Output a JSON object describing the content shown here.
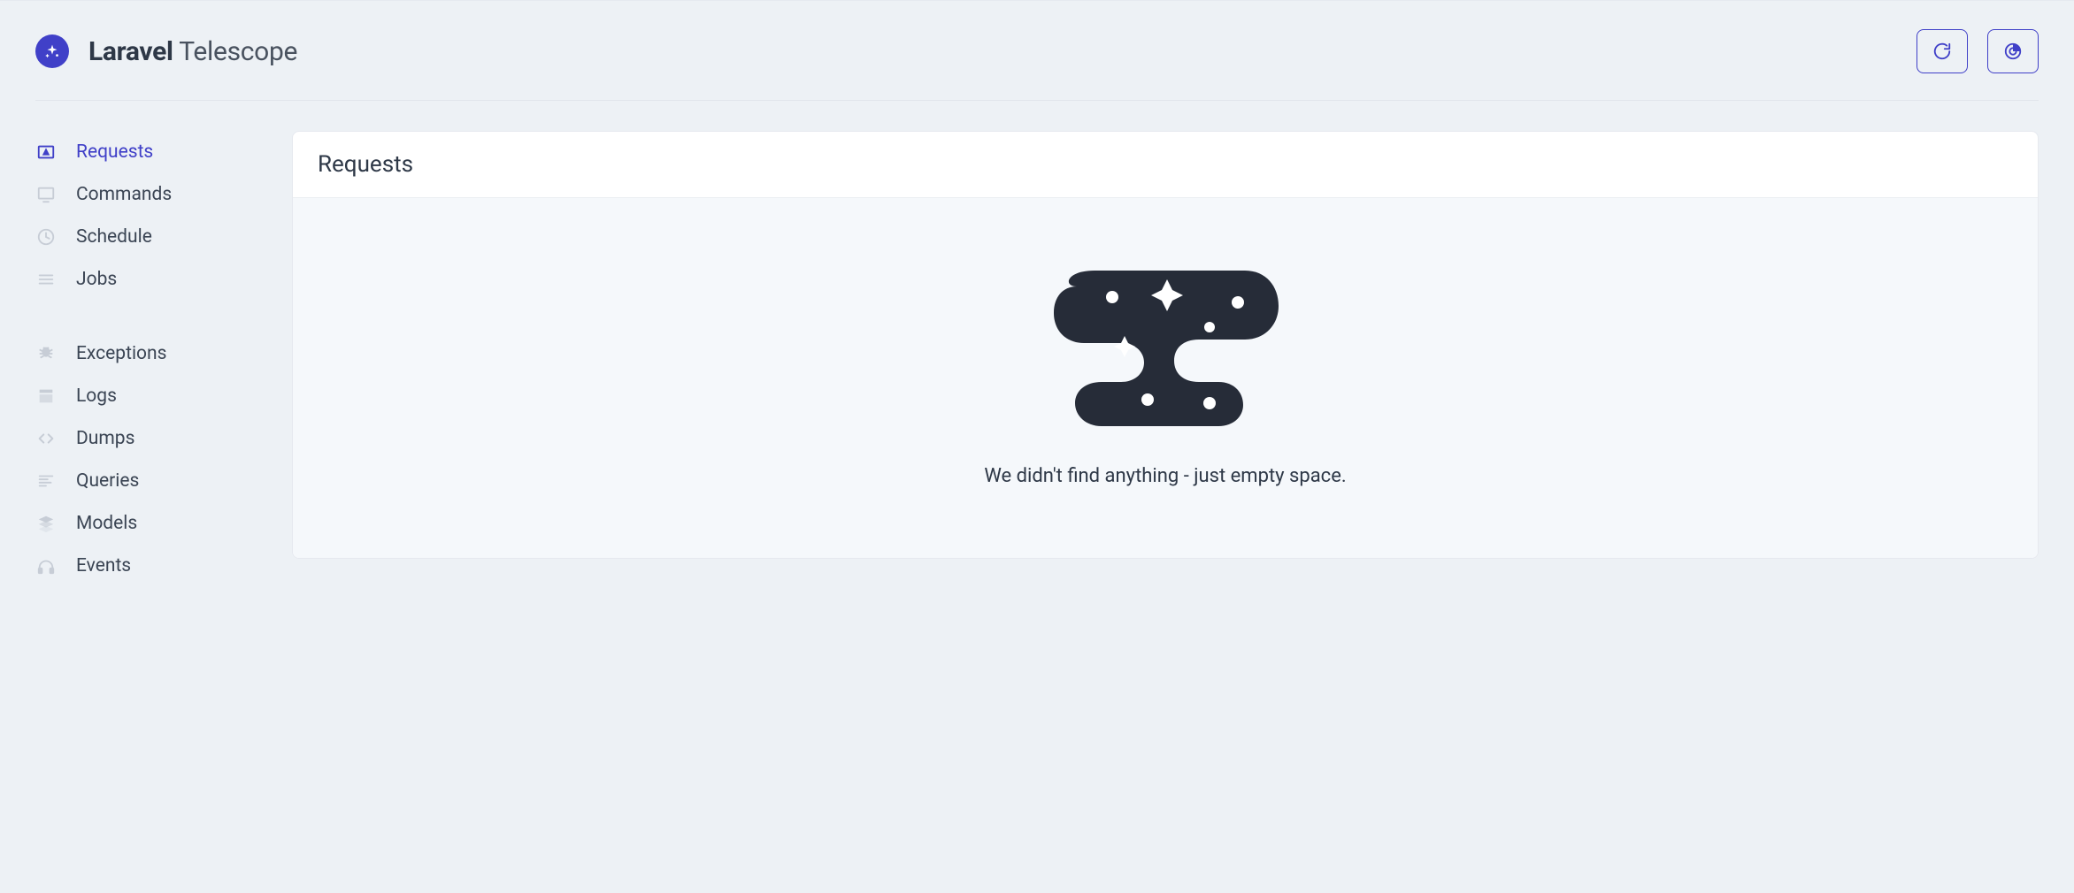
{
  "brand": {
    "strong": "Laravel",
    "rest": " Telescope"
  },
  "sidebar": {
    "groups": [
      {
        "items": [
          {
            "label": "Requests",
            "icon": "requests",
            "active": true
          },
          {
            "label": "Commands",
            "icon": "commands",
            "active": false
          },
          {
            "label": "Schedule",
            "icon": "schedule",
            "active": false
          },
          {
            "label": "Jobs",
            "icon": "jobs",
            "active": false
          }
        ]
      },
      {
        "items": [
          {
            "label": "Exceptions",
            "icon": "exceptions",
            "active": false
          },
          {
            "label": "Logs",
            "icon": "logs",
            "active": false
          },
          {
            "label": "Dumps",
            "icon": "dumps",
            "active": false
          },
          {
            "label": "Queries",
            "icon": "queries",
            "active": false
          },
          {
            "label": "Models",
            "icon": "models",
            "active": false
          },
          {
            "label": "Events",
            "icon": "events",
            "active": false
          }
        ]
      }
    ]
  },
  "panel": {
    "title": "Requests",
    "empty_message": "We didn't find anything - just empty space."
  },
  "colors": {
    "accent": "#4040C8",
    "iconMuted": "#C7CDD6",
    "text": "#2E3847"
  }
}
